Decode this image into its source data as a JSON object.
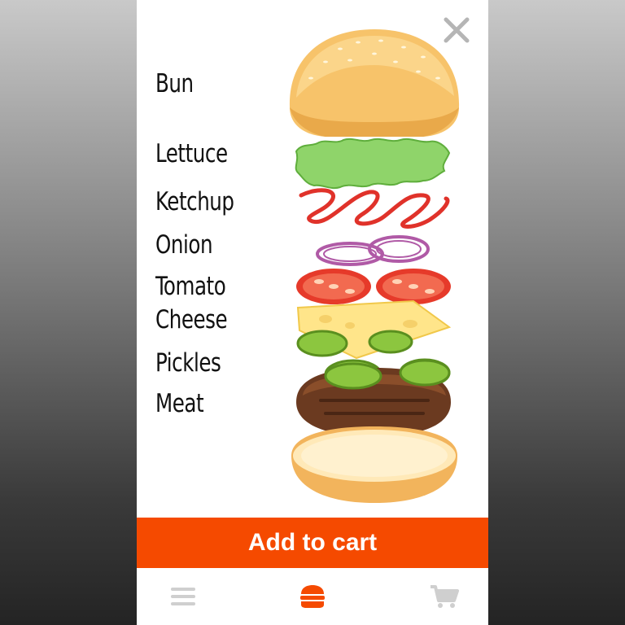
{
  "ingredients": [
    {
      "label": "Bun"
    },
    {
      "label": "Lettuce"
    },
    {
      "label": "Ketchup"
    },
    {
      "label": "Onion"
    },
    {
      "label": "Tomato"
    },
    {
      "label": "Cheese"
    },
    {
      "label": "Pickles"
    },
    {
      "label": "Meat"
    }
  ],
  "actions": {
    "add_to_cart_label": "Add to cart"
  },
  "tabs": [
    {
      "icon": "menu-icon",
      "active": false
    },
    {
      "icon": "burger-icon",
      "active": true
    },
    {
      "icon": "cart-icon",
      "active": false
    }
  ],
  "colors": {
    "accent": "#f54a00",
    "inactive_icon": "#cfcfcf"
  }
}
